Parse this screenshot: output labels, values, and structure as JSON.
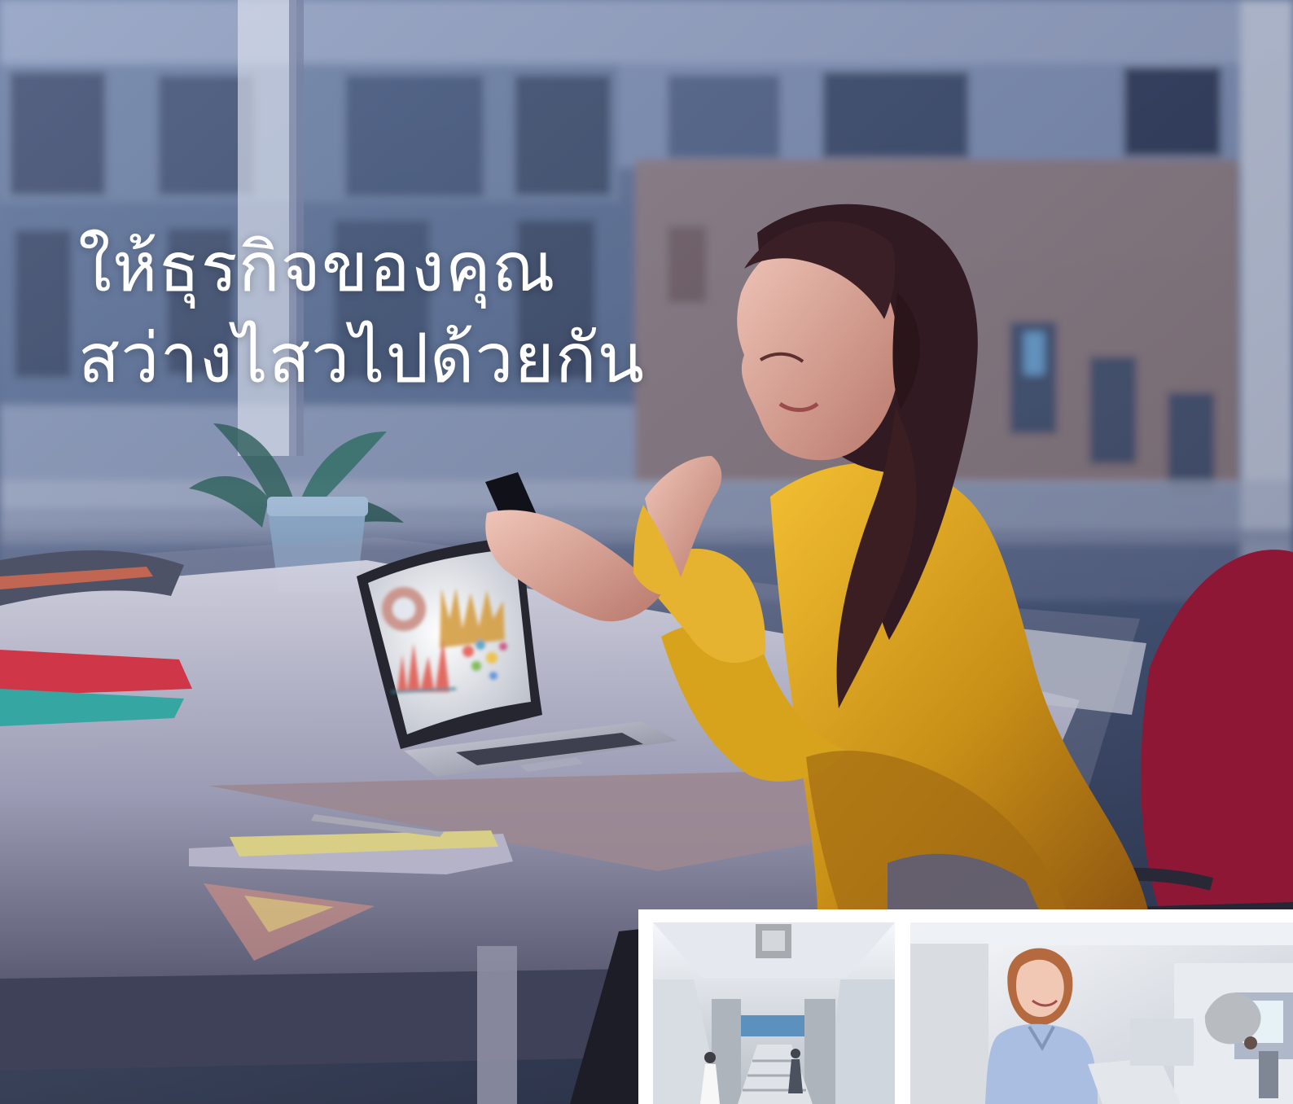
{
  "headline": {
    "line1": "ให้ธุรกิจของคุณ",
    "line2": "สว่างไสวไปด้วยกัน"
  },
  "colors": {
    "headline_text": "#ffffff",
    "blouse": "#d8a11f",
    "chair": "#8e1736",
    "night_window": "#4c5d85",
    "thumbnail_background": "#ffffff"
  }
}
